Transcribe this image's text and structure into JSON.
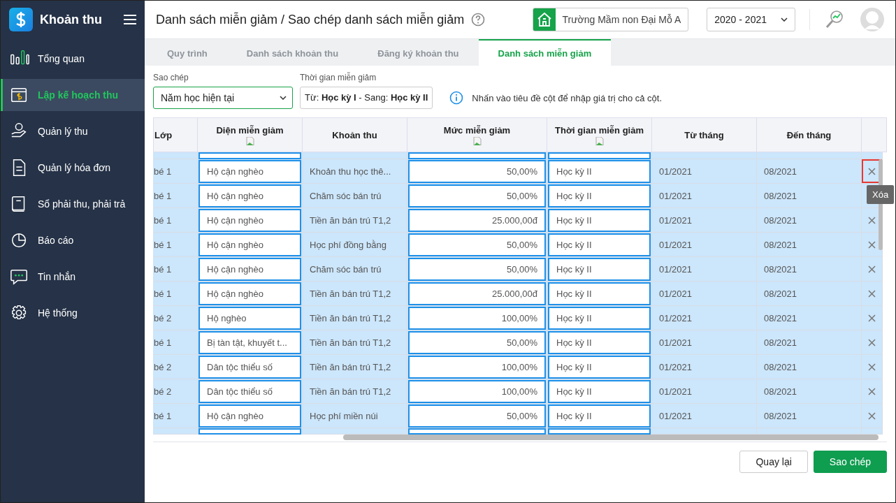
{
  "sidebar": {
    "app_title": "Khoản thu",
    "items": [
      {
        "label": "Tổng quan",
        "selected": false
      },
      {
        "label": "Lập kế hoạch thu",
        "selected": true
      },
      {
        "label": "Quản lý thu",
        "selected": false
      },
      {
        "label": "Quản lý hóa đơn",
        "selected": false
      },
      {
        "label": "Sổ phải thu, phải trả",
        "selected": false
      },
      {
        "label": "Báo cáo",
        "selected": false
      },
      {
        "label": "Tin nhắn",
        "selected": false
      },
      {
        "label": "Hệ thống",
        "selected": false
      }
    ]
  },
  "header": {
    "title": "Danh sách miễn giảm / Sao chép danh sách miễn giảm",
    "school": "Trường Mầm non Đại Mỗ A",
    "year": "2020 - 2021"
  },
  "tabs": [
    {
      "label": "Quy trình",
      "selected": false
    },
    {
      "label": "Danh sách khoản thu",
      "selected": false
    },
    {
      "label": "Đăng ký khoản thu",
      "selected": false
    },
    {
      "label": "Danh sách miễn giảm",
      "selected": true
    }
  ],
  "filters": {
    "copy_label": "Sao chép",
    "copy_value": "Năm học hiện tại",
    "period_label": "Thời gian miễn giảm",
    "period_value": "Từ: **Học kỳ I** - Sang: **Học kỳ II**",
    "info": "Nhấn vào tiêu đề cột để nhập giá trị cho cả cột."
  },
  "table": {
    "columns": [
      {
        "label": "Lớp",
        "kind": "text",
        "bulk_edit": false
      },
      {
        "label": "Diện miễn giảm",
        "kind": "input",
        "bulk_edit": true
      },
      {
        "label": "Khoản thu",
        "kind": "text",
        "bulk_edit": false
      },
      {
        "label": "Mức miễn giảm",
        "kind": "number",
        "bulk_edit": true
      },
      {
        "label": "Thời gian miễn giảm",
        "kind": "input",
        "bulk_edit": true
      },
      {
        "label": "Từ tháng",
        "kind": "text",
        "bulk_edit": false
      },
      {
        "label": "Đến tháng",
        "kind": "text",
        "bulk_edit": false
      }
    ],
    "rows": [
      {
        "cells": [
          "bé 1",
          "Hộ cận nghèo",
          "Khoản thu học thê...",
          "50,00%",
          "Học kỳ II",
          "01/2021",
          "08/2021"
        ],
        "highlighted": true,
        "tooltip": "Xóa"
      },
      {
        "cells": [
          "bé 1",
          "Hộ cận nghèo",
          "Chăm sóc bán trú",
          "50,00%",
          "Học kỳ II",
          "01/2021",
          "08/2021"
        ],
        "highlighted": false
      },
      {
        "cells": [
          "bé 1",
          "Hộ cận nghèo",
          "Tiền ăn bán trú T1,2",
          "25.000,00đ",
          "Học kỳ II",
          "01/2021",
          "08/2021"
        ],
        "highlighted": false
      },
      {
        "cells": [
          "bé 1",
          "Hộ cận nghèo",
          "Học phí đồng bằng",
          "50,00%",
          "Học kỳ II",
          "01/2021",
          "08/2021"
        ],
        "highlighted": false
      },
      {
        "cells": [
          "bé 1",
          "Hộ cận nghèo",
          "Chăm sóc bán trú",
          "50,00%",
          "Học kỳ II",
          "01/2021",
          "08/2021"
        ],
        "highlighted": false
      },
      {
        "cells": [
          "bé 1",
          "Hộ cận nghèo",
          "Tiền ăn bán trú T1,2",
          "25.000,00đ",
          "Học kỳ II",
          "01/2021",
          "08/2021"
        ],
        "highlighted": false
      },
      {
        "cells": [
          "bé 2",
          "Hộ nghèo",
          "Tiền ăn bán trú T1,2",
          "100,00%",
          "Học kỳ II",
          "01/2021",
          "08/2021"
        ],
        "highlighted": false
      },
      {
        "cells": [
          "bé 1",
          "Bị tàn tật, khuyết t...",
          "Tiền ăn bán trú T1,2",
          "50,00%",
          "Học kỳ II",
          "01/2021",
          "08/2021"
        ],
        "highlighted": false
      },
      {
        "cells": [
          "bé 2",
          "Dân tộc thiểu số",
          "Tiền ăn bán trú T1,2",
          "100,00%",
          "Học kỳ II",
          "01/2021",
          "08/2021"
        ],
        "highlighted": false
      },
      {
        "cells": [
          "bé 2",
          "Dân tộc thiểu số",
          "Tiền ăn bán trú T1,2",
          "100,00%",
          "Học kỳ II",
          "01/2021",
          "08/2021"
        ],
        "highlighted": false
      },
      {
        "cells": [
          "bé 1",
          "Hộ cận nghèo",
          "Học phí miền núi",
          "50,00%",
          "Học kỳ II",
          "01/2021",
          "08/2021"
        ],
        "highlighted": false
      }
    ]
  },
  "buttons": [
    {
      "label": "Quay lại",
      "kind": "secondary"
    },
    {
      "label": "Sao chép",
      "kind": "primary"
    }
  ]
}
